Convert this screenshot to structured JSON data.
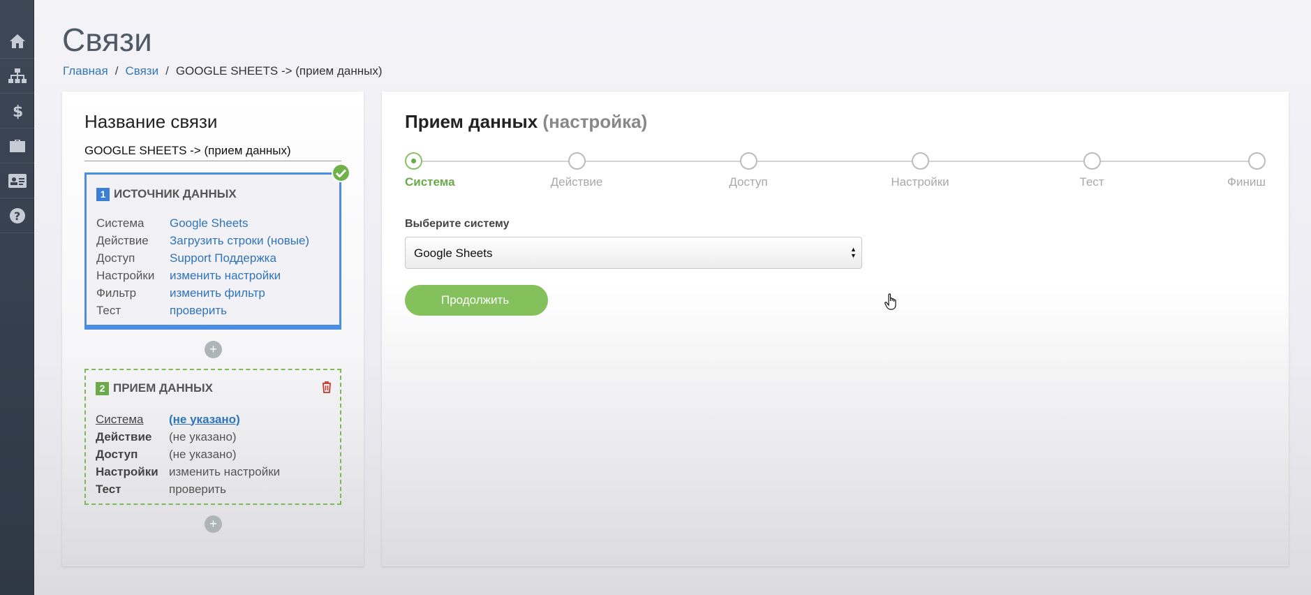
{
  "sidebar": {
    "items": [
      {
        "icon": "home-icon"
      },
      {
        "icon": "sitemap-icon"
      },
      {
        "icon": "dollar-icon"
      },
      {
        "icon": "briefcase-icon"
      },
      {
        "icon": "id-card-icon"
      },
      {
        "icon": "question-icon"
      }
    ]
  },
  "header": {
    "title": "Связи",
    "breadcrumb": [
      "Главная",
      "Связи",
      "GOOGLE SHEETS -> (прием данных)"
    ],
    "separator": "/"
  },
  "left_panel": {
    "title": "Название связи",
    "connection_name": "GOOGLE SHEETS -> (прием данных)",
    "source": {
      "number": "1",
      "title": "ИСТОЧНИК ДАННЫХ",
      "rows": [
        {
          "key": "Система",
          "value": "Google Sheets"
        },
        {
          "key": "Действие",
          "value": "Загрузить строки (новые)"
        },
        {
          "key": "Доступ",
          "value": "Support Поддержка"
        },
        {
          "key": "Настройки",
          "value": "изменить настройки"
        },
        {
          "key": "Фильтр",
          "value": "изменить фильтр"
        },
        {
          "key": "Тест",
          "value": "проверить"
        }
      ]
    },
    "receiver": {
      "number": "2",
      "title": "ПРИЕМ ДАННЫХ",
      "rows": [
        {
          "key": "Система",
          "value": "(не указано)"
        },
        {
          "key": "Действие",
          "value": "(не указано)"
        },
        {
          "key": "Доступ",
          "value": "(не указано)"
        },
        {
          "key": "Настройки",
          "value": "изменить настройки"
        },
        {
          "key": "Тест",
          "value": "проверить"
        }
      ]
    },
    "plus": "+"
  },
  "right_panel": {
    "title": "Прием данных",
    "subtitle": "(настройка)",
    "steps": [
      "Система",
      "Действие",
      "Доступ",
      "Настройки",
      "Тест",
      "Финиш"
    ],
    "active_step": 0,
    "select_label": "Выберите систему",
    "select_value": "Google Sheets",
    "continue_label": "Продолжить"
  },
  "colors": {
    "accent_green": "#84c15d",
    "link_blue": "#2f73b8",
    "source_border": "#4a8de3",
    "sidebar_bg": "#3d4756"
  }
}
